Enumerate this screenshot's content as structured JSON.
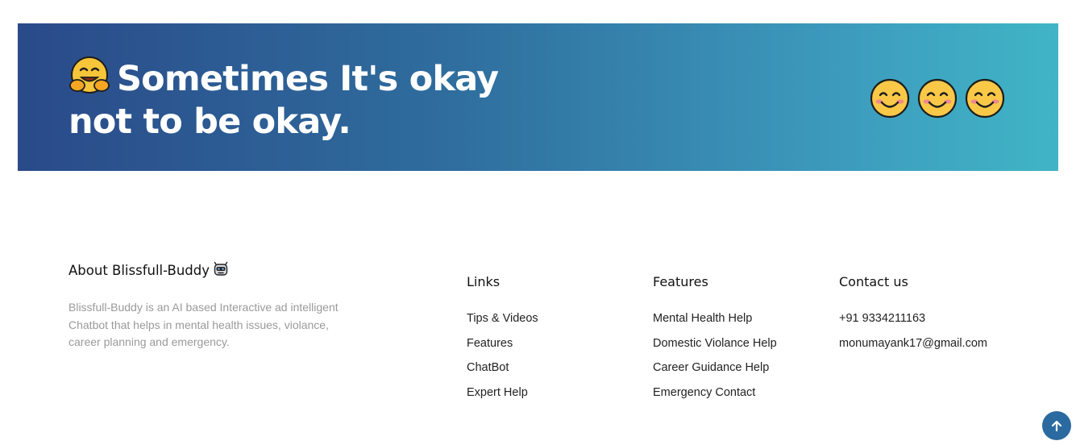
{
  "banner": {
    "title_line1": "Sometimes It's okay",
    "title_line2": "not to be okay.",
    "leading_icon": "hugging-face-emoji",
    "trailing_icons": [
      "smiling-face-emoji",
      "smiling-face-emoji",
      "smiling-face-emoji"
    ],
    "gradient_start": "#2a4a89",
    "gradient_end": "#40b5c6"
  },
  "about": {
    "heading": "About Blissfull-Buddy",
    "heading_icon": "robot-face-emoji",
    "text": "Blissfull-Buddy is an AI based Interactive ad intelligent Chatbot that helps in mental health issues, violance, career planning and emergency."
  },
  "links": {
    "heading": "Links",
    "items": [
      "Tips & Videos",
      "Features",
      "ChatBot",
      "Expert Help"
    ]
  },
  "features": {
    "heading": "Features",
    "items": [
      "Mental Health Help",
      "Domestic Violance Help",
      "Career Guidance Help",
      "Emergency Contact"
    ]
  },
  "contact": {
    "heading": "Contact us",
    "phone": "+91 9334211163",
    "email": "monumayank17@gmail.com"
  },
  "scroll_top": {
    "icon": "arrow-up-icon",
    "color": "#2b6aa0"
  }
}
